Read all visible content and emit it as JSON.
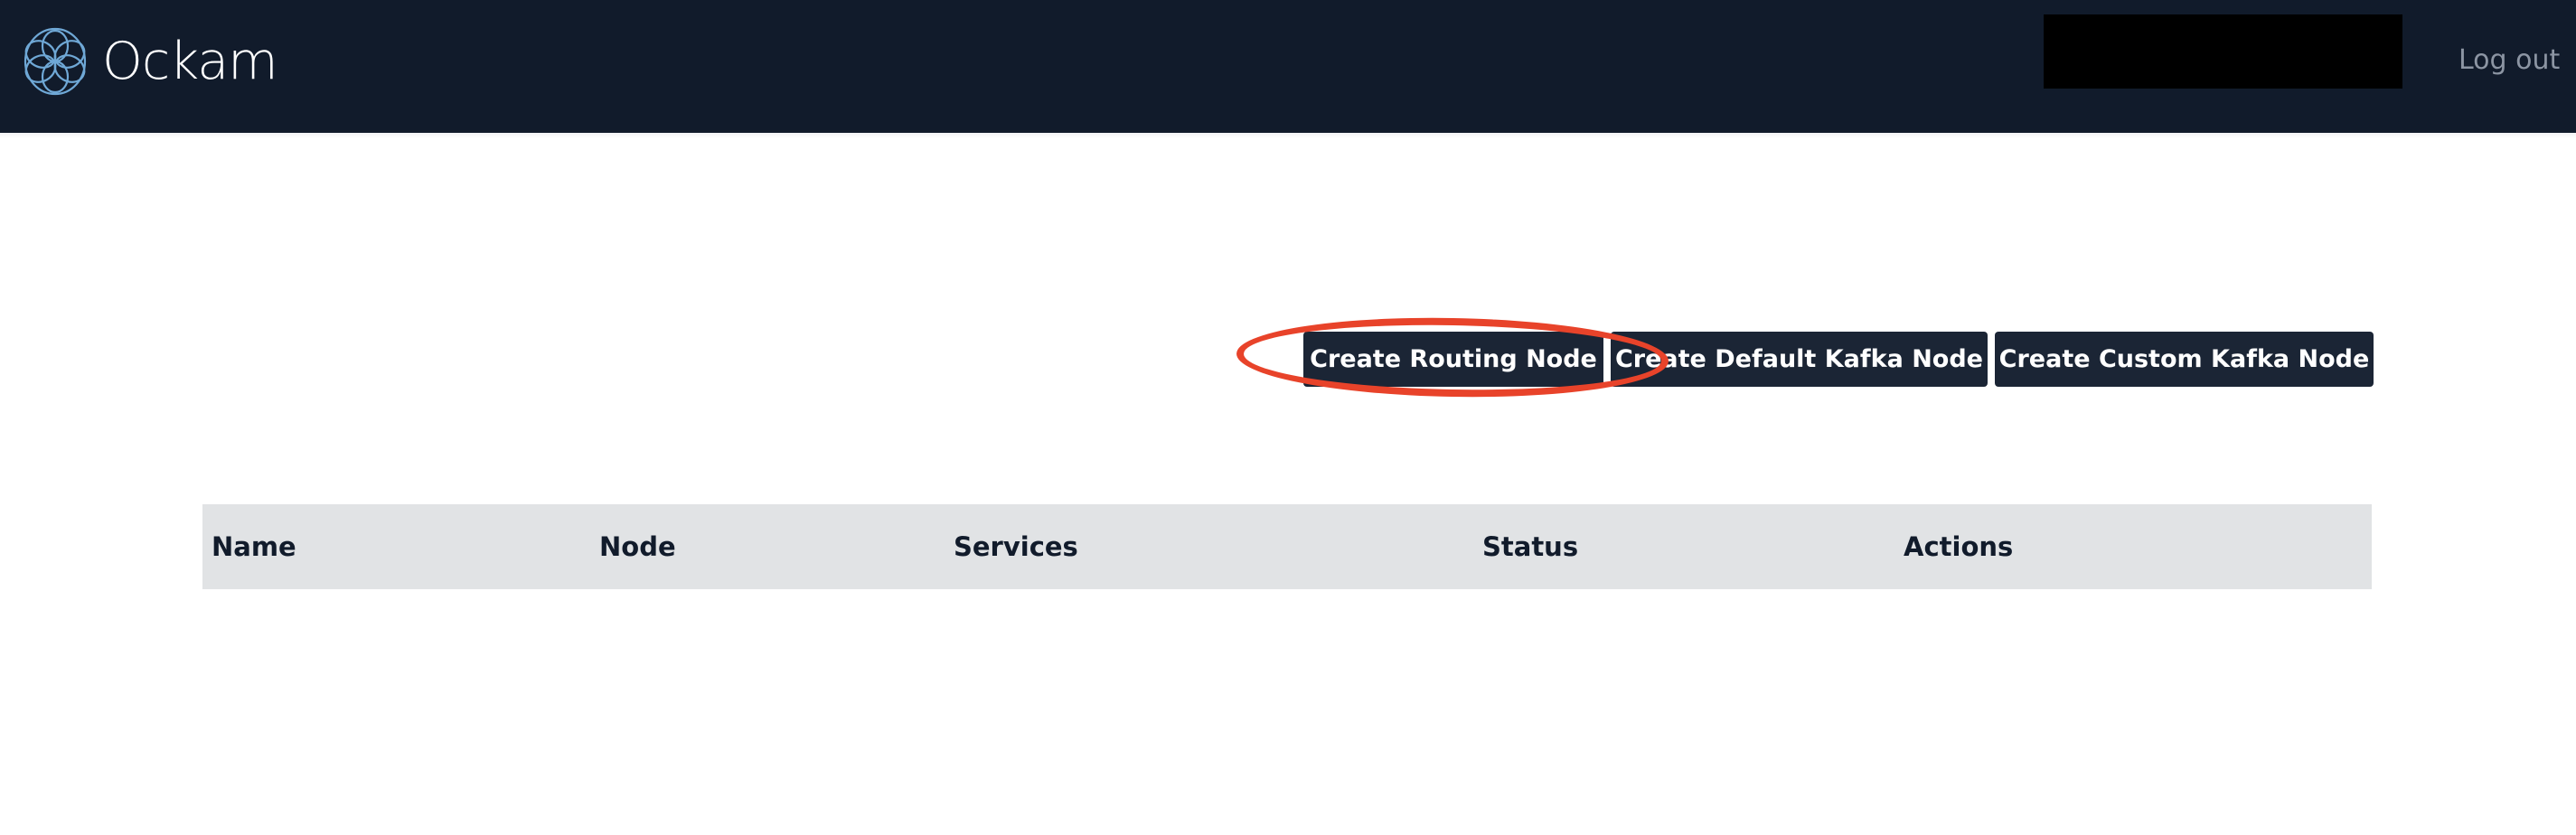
{
  "header": {
    "brand": "Ockam",
    "logout_label": "Log out",
    "colors": {
      "background": "#111b2b",
      "logo_accent": "#6fa8d6"
    }
  },
  "toolbar": {
    "buttons": [
      {
        "label": "Create Routing Node",
        "highlighted": true
      },
      {
        "label": "Create Default Kafka Node"
      },
      {
        "label": "Create Custom Kafka Node"
      }
    ],
    "highlight_color": "#e8432a"
  },
  "table": {
    "columns": [
      "Name",
      "Node",
      "Services",
      "Status",
      "Actions"
    ],
    "rows": []
  }
}
